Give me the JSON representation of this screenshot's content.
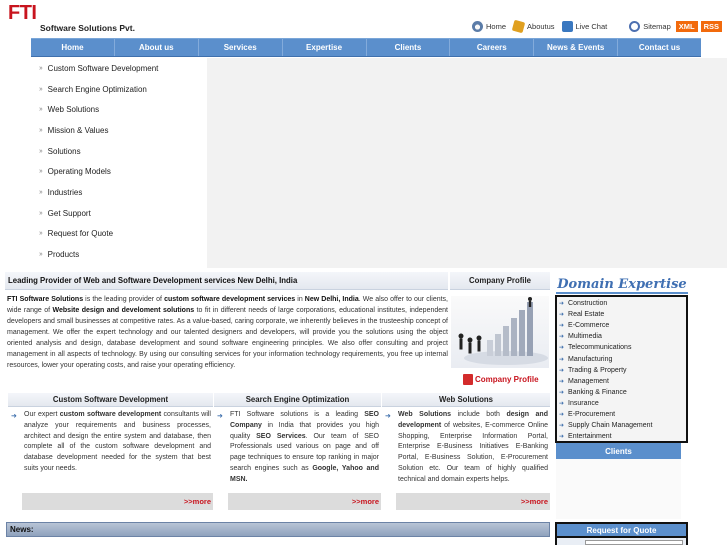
{
  "header": {
    "logo": "FTI",
    "company_name": "Software Solutions Pvt.",
    "toplinks": [
      "Home",
      "Aboutus",
      "Live Chat",
      "Sitemap"
    ],
    "badges": [
      "XML",
      "RSS"
    ]
  },
  "nav": [
    "Home",
    "About us",
    "Services",
    "Expertise",
    "Clients",
    "Careers",
    "News & Events",
    "Contact us"
  ],
  "sidemenu": [
    "Custom Software Development",
    "Search Engine Optimization",
    "Web Solutions",
    "Mission & Values",
    "Solutions",
    "Operating Models",
    "Industries",
    "Get Support",
    "Request for Quote",
    "Products"
  ],
  "intro": {
    "heading": "Leading Provider of Web and Software Development services New Delhi, India",
    "p1_b1": "FTI Software Solutions",
    "p1_t1": " is the leading provider of ",
    "p1_b2": "custom software development services",
    "p1_t2": " in ",
    "p1_b3": "New Delhi, India",
    "p1_t3": ". We also offer to our clients, wide range of ",
    "p1_b4": "Website design and develoment solutions",
    "p1_t4": " to fit in different needs of large corporations, educational institutes, independent developers and small businesses at competitive rates. As a value-based, caring corporate, we inherently believes in the trusteeship concept of management. We offer the expert technology and our talented designers and developers, will provide you the solutions using the object oriented analysis and design, database development and sound software engineering principles. We also offer consulting and project management in all aspects of technology. By using our consulting services for your information technology requirements, you free up internal resources, lower your operating costs, and raise your operating efficiency."
  },
  "company_profile": {
    "heading": "Company Profile",
    "link": "Company Profile"
  },
  "columns": [
    {
      "heading": "Custom Software Development",
      "t1": "Our expert ",
      "b1": "custom software development",
      "t2": " consultants will analyze your requirements and business processes, architect and design the entire system and database, then complete all of the custom software development and database development needed for the system that best suits your needs.",
      "more": ">>more"
    },
    {
      "heading": "Search Engine Optimization",
      "t1": "FTI Software solutions is a leading ",
      "b1": "SEO Company",
      "t2": " in India that provides you high quality ",
      "b2": "SEO Services",
      "t3": ". Our team of SEO Professionals used various on page and off page techniques to ensure top ranking in major search engines such as ",
      "b3": "Google, Yahoo and MSN.",
      "more": ">>more"
    },
    {
      "heading": "Web Solutions",
      "b1": "Web Solutions",
      "t1": " include both ",
      "b2": "design and development",
      "t2": " of websites, E-commerce Online Shopping, Enterprise Information Portal, Enterprise E-Business Initiatives E-Banking Portal, E-Business Solution, E-Procurement Solution etc. Our team of highly qualified technical and domain experts helps.",
      "more": ">>more"
    }
  ],
  "news": {
    "heading": "News:"
  },
  "domain_expertise": {
    "title": "Domain Expertise",
    "items": [
      "Construction",
      "Real Estate",
      "E-Commerce",
      "Multimedia",
      "Telecommunications",
      "Manufacturing",
      "Trading & Property",
      "Management",
      "Banking & Finance",
      "Insurance",
      "E-Procurement",
      "Supply Chain Management",
      "Entertainment"
    ]
  },
  "clients": {
    "heading": "Clients"
  },
  "request_quote": {
    "heading": "Request for Quote"
  },
  "colors": {
    "nav_blue": "#5b8fcc",
    "brand_red": "#c8141e",
    "badge_orange": "#f26a0c"
  }
}
